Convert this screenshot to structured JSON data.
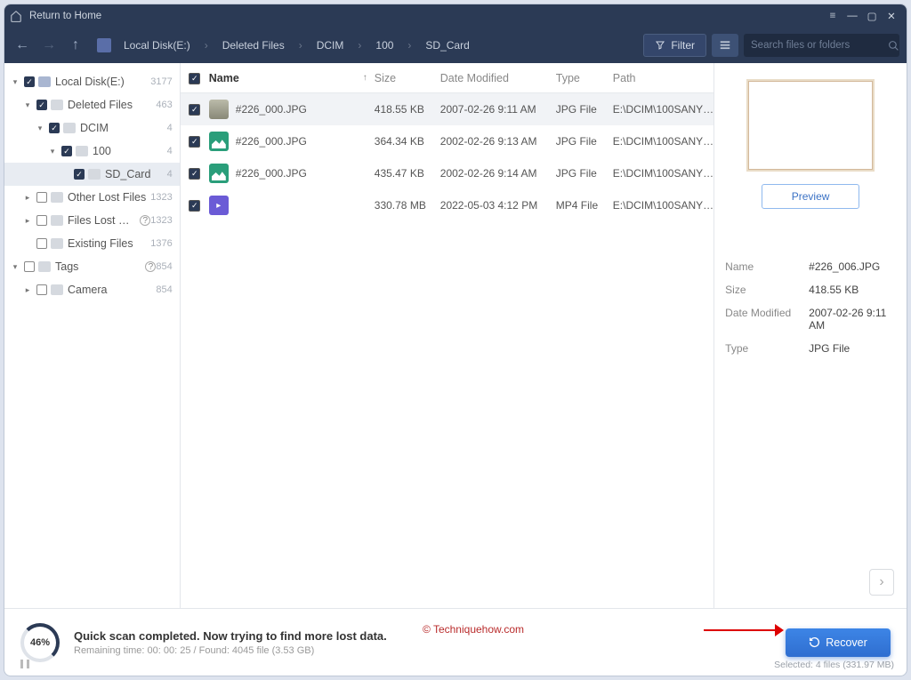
{
  "titlebar": {
    "return": "Return to Home"
  },
  "toolbar": {
    "breadcrumb": [
      "Local Disk(E:)",
      "Deleted Files",
      "DCIM",
      "100",
      "SD_Card"
    ],
    "filter": "Filter",
    "search_ph": "Search files or folders"
  },
  "tree": [
    {
      "depth": 0,
      "arr": "▾",
      "chk": true,
      "drive": true,
      "label": "Local Disk(E:)",
      "cnt": "3177"
    },
    {
      "depth": 1,
      "arr": "▾",
      "chk": true,
      "label": "Deleted Files",
      "cnt": "463"
    },
    {
      "depth": 2,
      "arr": "▾",
      "chk": true,
      "label": "DCIM",
      "cnt": "4"
    },
    {
      "depth": 3,
      "arr": "▾",
      "chk": true,
      "label": "100",
      "cnt": "4"
    },
    {
      "depth": 4,
      "arr": "",
      "chk": true,
      "label": "SD_Card",
      "cnt": "4",
      "sel": true
    },
    {
      "depth": 1,
      "arr": "▸",
      "chk": false,
      "label": "Other Lost Files",
      "cnt": "1323"
    },
    {
      "depth": 1,
      "arr": "▸",
      "chk": false,
      "label": "Files Lost Original…",
      "cnt": "1323",
      "help": true
    },
    {
      "depth": 1,
      "arr": "",
      "chk": false,
      "label": "Existing Files",
      "cnt": "1376"
    },
    {
      "depth": 0,
      "arr": "▾",
      "chk": false,
      "label": "Tags",
      "cnt": "854",
      "help": true
    },
    {
      "depth": 1,
      "arr": "▸",
      "chk": false,
      "label": "Camera",
      "cnt": "854"
    }
  ],
  "cols": {
    "name": "Name",
    "size": "Size",
    "date": "Date Modified",
    "type": "Type",
    "path": "Path"
  },
  "rows": [
    {
      "ico": "img",
      "name": "#226_000.JPG",
      "size": "418.55 KB",
      "date": "2007-02-26 9:11 AM",
      "type": "JPG File",
      "path": "E:\\DCIM\\100SANY…",
      "sel": true
    },
    {
      "ico": "jpg",
      "name": "#226_000.JPG",
      "size": "364.34 KB",
      "date": "2002-02-26 9:13 AM",
      "type": "JPG File",
      "path": "E:\\DCIM\\100SANY…"
    },
    {
      "ico": "jpg",
      "name": "#226_000.JPG",
      "size": "435.47 KB",
      "date": "2002-02-26 9:14 AM",
      "type": "JPG File",
      "path": "E:\\DCIM\\100SANY…"
    },
    {
      "ico": "vid",
      "name": "",
      "size": "330.78 MB",
      "date": "2022-05-03 4:12 PM",
      "type": "MP4 File",
      "path": "E:\\DCIM\\100SANY…"
    }
  ],
  "preview": {
    "btn": "Preview",
    "info": [
      {
        "k": "Name",
        "v": "#226_006.JPG"
      },
      {
        "k": "Size",
        "v": "418.55 KB"
      },
      {
        "k": "Date Modified",
        "v": "2007-02-26 9:11 AM"
      },
      {
        "k": "Type",
        "v": "JPG File"
      }
    ]
  },
  "footer": {
    "pct": "46%",
    "title": "Quick scan completed. Now trying to find more lost data.",
    "sub": "Remaining time: 00: 00: 25 / Found: 4045 file (3.53 GB)",
    "watermark": "© Techniquehow.com",
    "recover": "Recover",
    "selected": "Selected: 4 files (331.97 MB)"
  }
}
